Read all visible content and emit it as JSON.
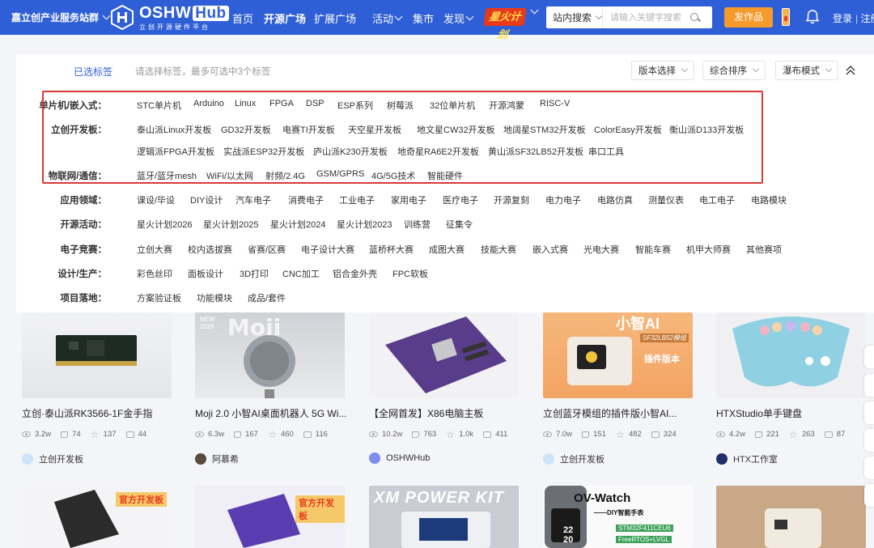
{
  "header": {
    "portal": "嘉立创产业服务站群",
    "logo_main": "OSHW",
    "logo_hub": "Hub",
    "logo_sub": "立创开源硬件平台",
    "nav": [
      {
        "label": "首页"
      },
      {
        "label": "开源广场"
      },
      {
        "label": "扩展广场"
      },
      {
        "label": "活动"
      },
      {
        "label": "集市"
      },
      {
        "label": "发现"
      }
    ],
    "spark_label": "星火计划",
    "search_scope": "站内搜索",
    "search_placeholder": "请输入关键字搜索",
    "publish_label": "发作品",
    "login": "登录",
    "register": "注册"
  },
  "filters": {
    "selected_label": "已选标签",
    "hint": "请选择标签，最多可选中3个标签",
    "version": "版本选择",
    "sort": "综合排序",
    "layout": "瀑布模式",
    "rows": [
      {
        "label": "单片机/嵌入式：",
        "tags": [
          "STC单片机",
          "Arduino",
          "Linux",
          "FPGA",
          "DSP",
          "ESP系列",
          "树莓派",
          "32位单片机",
          "开源鸿蒙",
          "RISC-V"
        ]
      },
      {
        "label": "立创开发板：",
        "tags": [
          "泰山派Linux开发板",
          "GD32开发板",
          "电赛TI开发板",
          "天空星开发板",
          "地文星CW32开发板",
          "地阔星STM32开发板",
          "ColorEasy开发板",
          "衡山派D133开发板"
        ]
      },
      {
        "label": "",
        "tags": [
          "逻辑派FPGA开发板",
          "实战派ESP32开发板",
          "庐山派K230开发板",
          "地奇星RA6E2开发板",
          "黄山派SF32LB52开发板",
          "串口工具"
        ]
      },
      {
        "label": "物联网/通信：",
        "tags": [
          "蓝牙/蓝牙mesh",
          "WiFi/以太网",
          "射频/2.4G",
          "GSM/GPRS",
          "4G/5G技术",
          "智能硬件"
        ]
      },
      {
        "label": "应用领域：",
        "tags": [
          "课设/毕设",
          "DIY设计",
          "汽车电子",
          "消费电子",
          "工业电子",
          "家用电子",
          "医疗电子",
          "开源复刻",
          "电力电子",
          "电路仿真",
          "测量仪表",
          "电工电子",
          "电路模块"
        ]
      },
      {
        "label": "开源活动：",
        "tags": [
          "星火计划2026",
          "星火计划2025",
          "星火计划2024",
          "星火计划2023",
          "训练营",
          "征集令"
        ]
      },
      {
        "label": "电子竞赛：",
        "tags": [
          "立创大赛",
          "校内选拔赛",
          "省赛/区赛",
          "电子设计大赛",
          "蓝桥杯大赛",
          "成图大赛",
          "技能大赛",
          "嵌入式赛",
          "光电大赛",
          "智能车赛",
          "机甲大师赛",
          "其他赛项"
        ]
      },
      {
        "label": "设计/生产：",
        "tags": [
          "彩色丝印",
          "面板设计",
          "3D打印",
          "CNC加工",
          "铝合金外壳",
          "FPC软板"
        ]
      },
      {
        "label": "项目落地：",
        "tags": [
          "方案验证板",
          "功能模块",
          "成品/套件"
        ]
      }
    ]
  },
  "cards": [
    {
      "title": "立创·泰山派RK3566-1F金手指",
      "views": "3.2w",
      "likes": "74",
      "stars": "137",
      "comments": "44",
      "author": "立创开发板"
    },
    {
      "title": "Moji 2.0 小智AI桌面机器人 5G Wi...",
      "views": "6.3w",
      "likes": "167",
      "stars": "460",
      "comments": "116",
      "author": "阿慕希",
      "img_text": "Moji",
      "img_badge": "NEW 2026"
    },
    {
      "title": "【全网首发】X86电脑主板",
      "views": "10.2w",
      "likes": "763",
      "stars": "1.0k",
      "comments": "411",
      "author": "OSHWHub"
    },
    {
      "title": "立创蓝牙模组的插件版小智AI...",
      "views": "7.0w",
      "likes": "151",
      "stars": "482",
      "comments": "324",
      "author": "立创开发板",
      "img_text": "小智AI",
      "img_badge": "SF32LB52模组",
      "img_badge2": "插件版本"
    },
    {
      "title": "HTXStudio单手键盘",
      "views": "4.2w",
      "likes": "221",
      "stars": "263",
      "comments": "87",
      "author": "HTX工作室"
    }
  ],
  "cards_row2": [
    {
      "badge": "官方开发板"
    },
    {
      "badge": "官方开发板"
    },
    {
      "text": "XM POWER KIT"
    },
    {
      "text": "OV-Watch",
      "sub": "——DIY智能手表",
      "line1": "STM32F411CEU6",
      "line2": "FreeRTOS+LVGL",
      "line3": "22",
      "line4": "20"
    },
    {}
  ],
  "colors": {
    "brand": "#2f5fd6",
    "accent": "#f79a2c",
    "highlight": "#d93a36"
  }
}
